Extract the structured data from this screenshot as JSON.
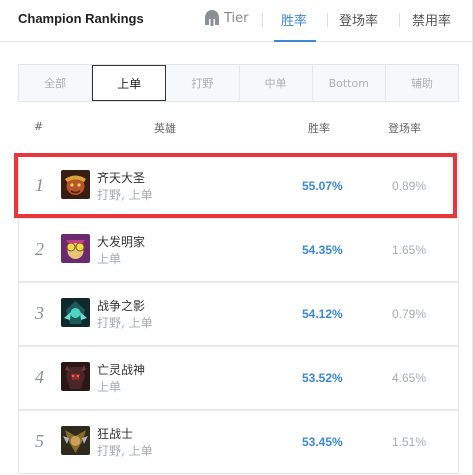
{
  "header": {
    "title": "Champion Rankings",
    "tabs": [
      {
        "label": "Tier",
        "icon": "helmet-icon",
        "active": false
      },
      {
        "label": "胜率",
        "active": true
      },
      {
        "label": "登场率",
        "active": false
      },
      {
        "label": "禁用率",
        "active": false
      }
    ]
  },
  "roles": [
    "全部",
    "上单",
    "打野",
    "中单",
    "Bottom",
    "辅助"
  ],
  "active_role": "上单",
  "table": {
    "headers": {
      "rank": "#",
      "hero": "英雄",
      "winrate": "胜率",
      "pickrate": "登场率"
    },
    "rows": [
      {
        "rank": "1",
        "name": "齐天大圣",
        "roles": "打野, 上单",
        "winrate": "55.07%",
        "pickrate": "0.89%",
        "highlighted": true
      },
      {
        "rank": "2",
        "name": "大发明家",
        "roles": "上单",
        "winrate": "54.35%",
        "pickrate": "1.65%"
      },
      {
        "rank": "3",
        "name": "战争之影",
        "roles": "打野, 上单",
        "winrate": "54.12%",
        "pickrate": "0.79%"
      },
      {
        "rank": "4",
        "name": "亡灵战神",
        "roles": "上单",
        "winrate": "53.52%",
        "pickrate": "4.65%"
      },
      {
        "rank": "5",
        "name": "狂战士",
        "roles": "打野, 上单",
        "winrate": "53.45%",
        "pickrate": "1.51%"
      }
    ]
  },
  "colors": {
    "accent": "#3b88d8",
    "highlight": "#e8363b"
  }
}
